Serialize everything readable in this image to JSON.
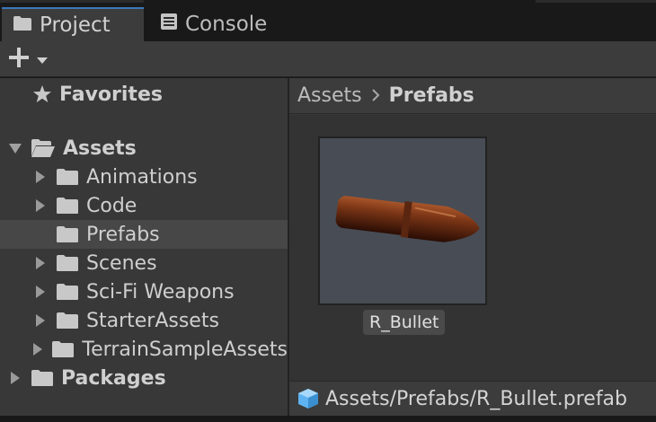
{
  "tabs": [
    {
      "label": "Project",
      "icon": "folder-icon"
    },
    {
      "label": "Console",
      "icon": "console-icon"
    }
  ],
  "toolbar": {
    "add_icon": "plus-dropdown-icon"
  },
  "tree": {
    "favorites": "Favorites",
    "assets": "Assets",
    "children": [
      "Animations",
      "Code",
      "Prefabs",
      "Scenes",
      "Sci-Fi Weapons",
      "StarterAssets",
      "TerrainSampleAssets"
    ],
    "selected": "Prefabs",
    "packages": "Packages"
  },
  "breadcrumb": {
    "root": "Assets",
    "current": "Prefabs"
  },
  "asset": {
    "name": "R_Bullet",
    "preview": "bullet-preview-icon"
  },
  "footer": {
    "path": "Assets/Prefabs/R_Bullet.prefab",
    "icon": "prefab-cube-icon"
  },
  "colors": {
    "selection": "#474747",
    "active_tab_accent": "#3a79bb",
    "prefab_icon": "#5fb3f0",
    "bullet": "#6b2f14"
  }
}
